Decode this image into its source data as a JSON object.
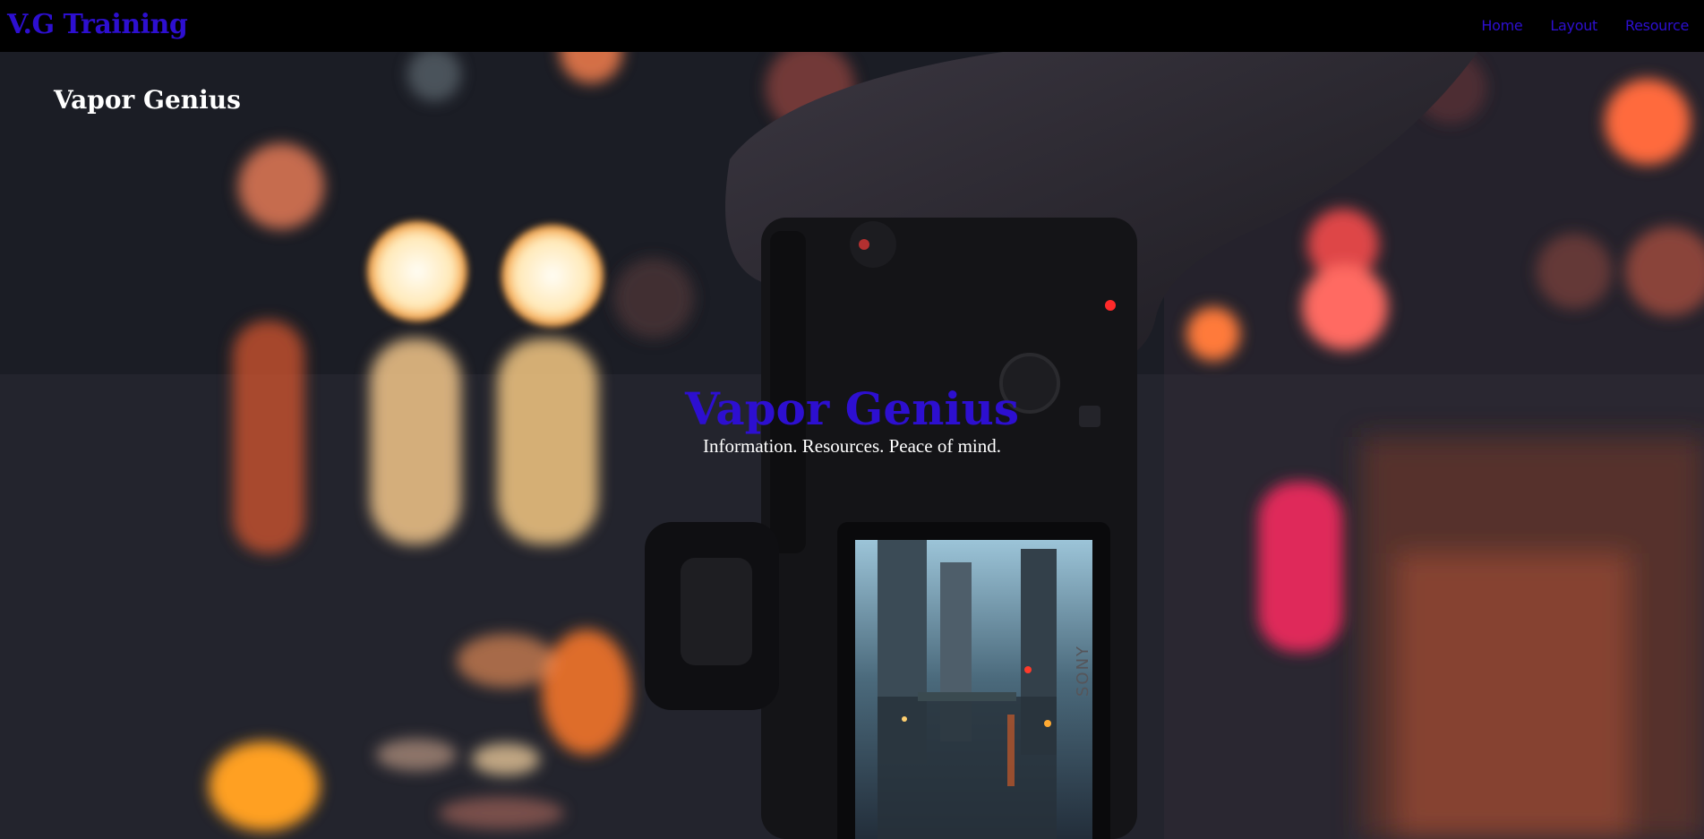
{
  "navbar": {
    "brand": "V.G Training",
    "links": [
      "Home",
      "Layout",
      "Resource"
    ]
  },
  "hero": {
    "side_title": "Vapor Genius",
    "title": "Vapor Genius",
    "tagline": "Information. Resources. Peace of mind.",
    "camera_brand": "SONY",
    "background_description": "camera-bokeh-night-photo"
  },
  "colors": {
    "accent": "#2d0fd0",
    "navbar_bg": "#000000",
    "text_light": "#ffffff"
  }
}
